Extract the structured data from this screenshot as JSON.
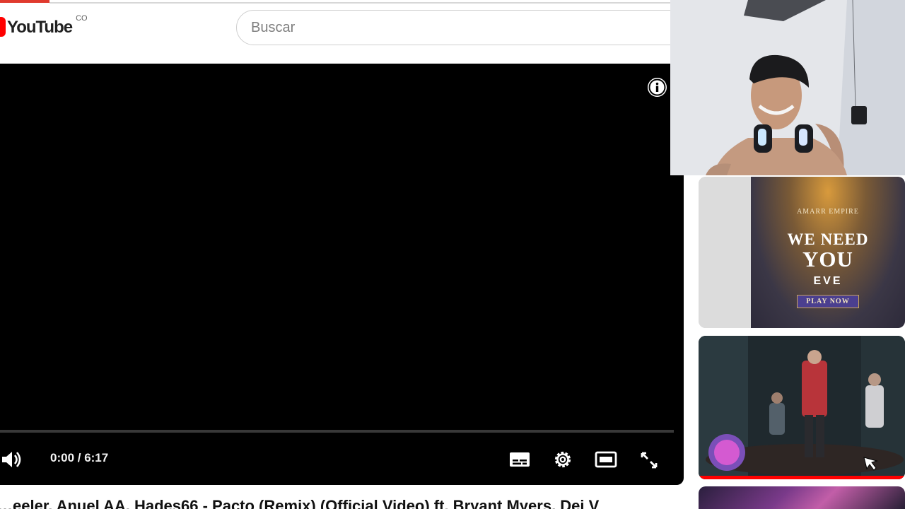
{
  "header": {
    "logo_text": "YouTube",
    "country_code": "CO",
    "search_placeholder": "Buscar"
  },
  "player": {
    "time_display": "0:00 / 6:17",
    "progress_fraction": 0,
    "icons": [
      "info-icon",
      "volume-icon",
      "subtitles-icon",
      "settings-icon",
      "theater-mode-icon",
      "fullscreen-icon"
    ]
  },
  "video": {
    "title": "…eeler, Anuel AA, Hades66 - Pacto (Remix) (Official Video) ft. Bryant Myers, Dei V"
  },
  "sidebar": {
    "ad": {
      "brand": "AMARR EMPIRE",
      "headline_line1": "WE NEED",
      "headline_line2": "YOU",
      "product": "EVE",
      "cta": "PLAY NOW"
    }
  },
  "colors": {
    "brand_red": "#ff0000",
    "accent_top": "#e03a2e",
    "ad_button": "#4b3f8f"
  }
}
